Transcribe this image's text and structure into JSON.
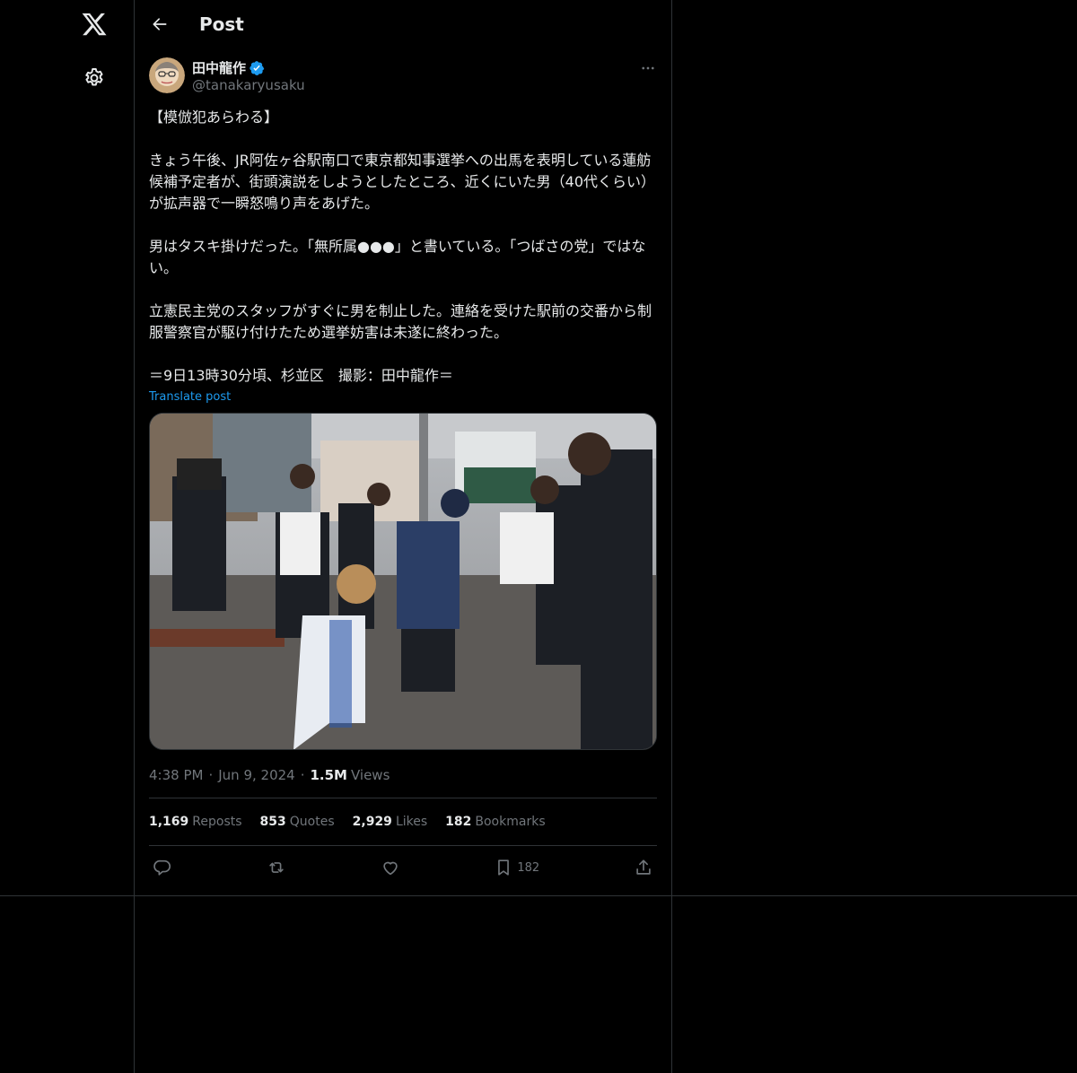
{
  "header": {
    "title": "Post"
  },
  "author": {
    "name": "田中龍作",
    "handle": "@tanakaryusaku"
  },
  "post": {
    "text": "【模倣犯あらわる】\n\nきょう午後、JR阿佐ヶ谷駅南口で東京都知事選挙への出馬を表明している蓮舫候補予定者が、街頭演説をしようとしたところ、近くにいた男（40代くらい）が拡声器で一瞬怒鳴り声をあげた。\n\n男はタスキ掛けだった。「無所属●●●」と書いている。「つばさの党」ではない。\n\n立憲民主党のスタッフがすぐに男を制止した。連絡を受けた駅前の交番から制服警察官が駆け付けたため選挙妨害は未遂に終わった。\n\n＝9日13時30分頃、杉並区　撮影：田中龍作＝",
    "translate_label": "Translate post",
    "time": "4:38 PM",
    "date": "Jun 9, 2024",
    "views_count": "1.5M",
    "views_label": "Views"
  },
  "stats": {
    "reposts_count": "1,169",
    "reposts_label": "Reposts",
    "quotes_count": "853",
    "quotes_label": "Quotes",
    "likes_count": "2,929",
    "likes_label": "Likes",
    "bookmarks_count": "182",
    "bookmarks_label": "Bookmarks"
  },
  "actions": {
    "bookmark_count": "182"
  },
  "icons": {
    "rail": [
      "x-logo-icon",
      "gear-icon"
    ],
    "header": [
      "back-arrow-icon"
    ],
    "author": [
      "verified-badge-icon",
      "more-icon"
    ],
    "actions": [
      "reply-icon",
      "repost-icon",
      "like-icon",
      "bookmark-icon",
      "share-icon"
    ]
  },
  "colors": {
    "background": "#000000",
    "text": "#e7e9ea",
    "muted": "#71767b",
    "accent": "#1d9bf0",
    "border": "#2f3336"
  }
}
